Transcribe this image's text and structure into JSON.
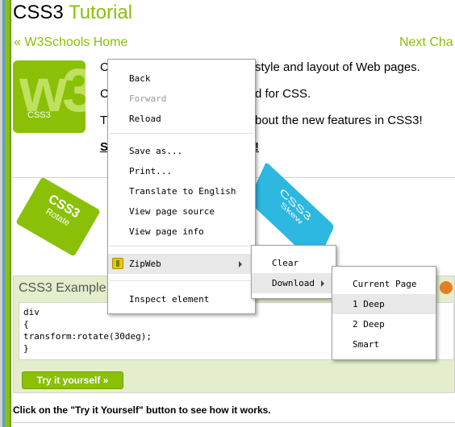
{
  "page": {
    "title_main": "CSS3",
    "title_accent": "Tutorial",
    "nav_prev": "« W3Schools Home",
    "nav_next": "Next Cha",
    "logo_text": "w3",
    "logo_sub": "CSS3",
    "intro_lines": [
      "C",
      "style and layout of Web pages.",
      "C",
      "d for CSS.",
      "T",
      "bout the new features in CSS3!",
      "S",
      "!"
    ],
    "card_green": {
      "line1": "CSS3",
      "line2": "Rotate"
    },
    "card_blue": {
      "line1": "CSS3",
      "line2": "Skew"
    },
    "example": {
      "title": "CSS3 Example",
      "code": [
        "div",
        "{",
        "transform:rotate(30deg);",
        "}"
      ],
      "try_button": "Try it yourself »"
    },
    "instructions": "Click on the \"Try it Yourself\" button to see how it works."
  },
  "context_menu": {
    "items": [
      {
        "label": "Back",
        "enabled": true
      },
      {
        "label": "Forward",
        "enabled": false
      },
      {
        "label": "Reload",
        "enabled": true
      },
      {
        "label": "Save as...",
        "enabled": true
      },
      {
        "label": "Print...",
        "enabled": true
      },
      {
        "label": "Translate to English",
        "enabled": true
      },
      {
        "label": "View page source",
        "enabled": true
      },
      {
        "label": "View page info",
        "enabled": true
      },
      {
        "label": "ZipWeb",
        "enabled": true,
        "icon": "zipweb-icon"
      },
      {
        "label": "Inspect element",
        "enabled": true
      }
    ]
  },
  "zipweb_menu": {
    "items": [
      {
        "label": "Clear"
      },
      {
        "label": "Download"
      }
    ]
  },
  "download_menu": {
    "items": [
      {
        "label": "Current Page"
      },
      {
        "label": "1 Deep"
      },
      {
        "label": "2 Deep"
      },
      {
        "label": "Smart"
      }
    ],
    "highlighted": "1 Deep"
  },
  "colors": {
    "accent": "#8ac007",
    "menu_hover": "#e8e8e8",
    "example_bg": "#e5eecc",
    "card_blue": "#2cb8e0"
  }
}
